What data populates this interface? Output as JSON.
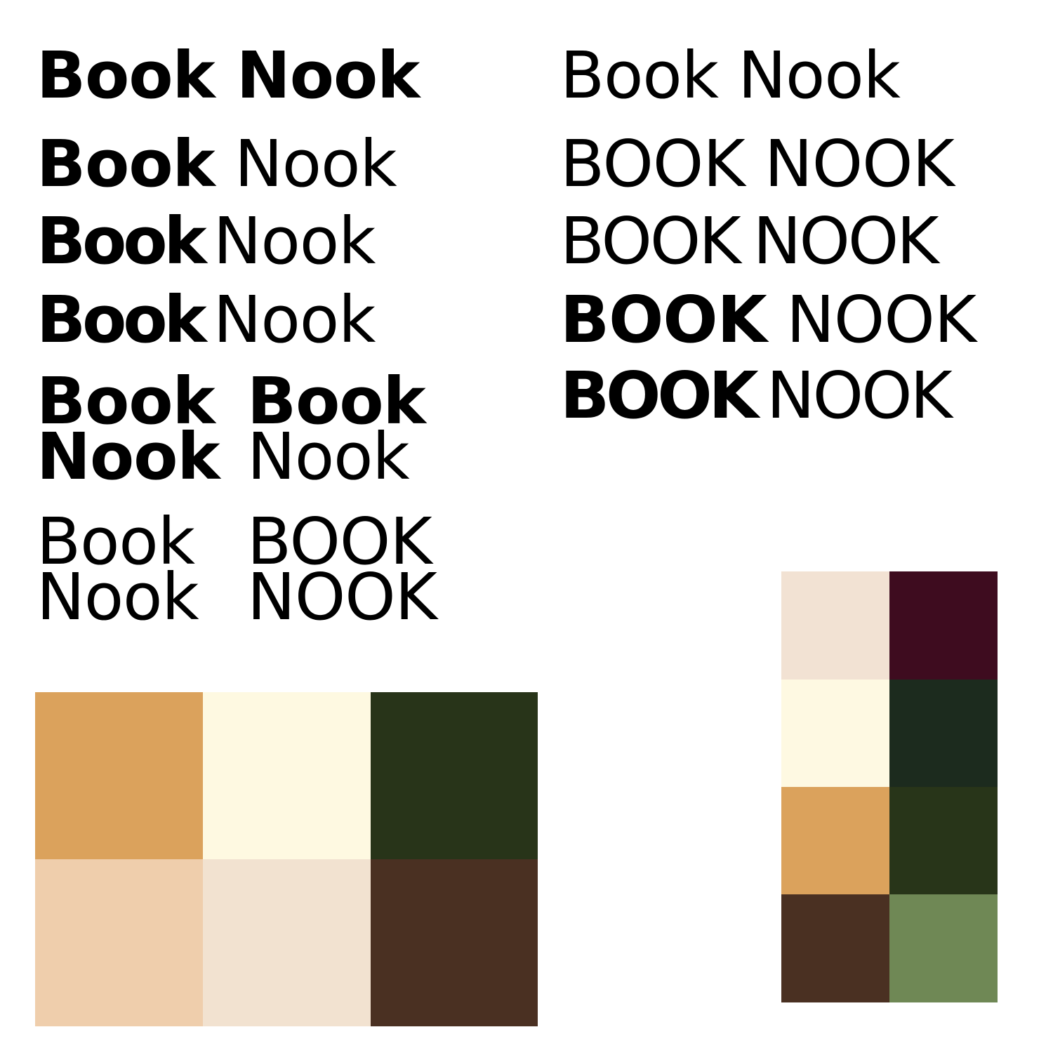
{
  "wordmarks": {
    "row1_left": {
      "word1": "Book",
      "word2": "Nook"
    },
    "row2_left": {
      "word1": "Book",
      "word2": "Nook"
    },
    "row3_left": {
      "word1": "Book",
      "word2": "Nook"
    },
    "row4_left": {
      "word1": "Book",
      "word2": "Nook"
    },
    "stack1": {
      "line1": "Book",
      "line2": "Nook"
    },
    "stack2": {
      "line1": "Book",
      "line2": "Nook"
    },
    "stack3": {
      "line1": "Book",
      "line2": "Nook"
    },
    "stack4": {
      "line1": "BOOK",
      "line2": "NOOK"
    },
    "row1_right": {
      "word1": "Book",
      "word2": "Nook"
    },
    "row2_right": {
      "word1": "BOOK",
      "word2": "NOOK"
    },
    "row3_right": {
      "word1": "BOOK",
      "word2": "NOOK"
    },
    "row4_right": {
      "word1": "BOOK",
      "word2": "NOOK"
    },
    "row5_right": {
      "word1": "BOOK",
      "word2": "NOOK"
    }
  },
  "palette_primary": [
    "#DBA25C",
    "#FEF9E1",
    "#283419",
    "#EFCEAC",
    "#F2E2D0",
    "#4A3022"
  ],
  "palette_secondary": [
    "#F2E2D3",
    "#3E0C1F",
    "#FEF9E2",
    "#1C2B1E",
    "#DBA25C",
    "#283519",
    "#4A3022",
    "#6F8855"
  ]
}
